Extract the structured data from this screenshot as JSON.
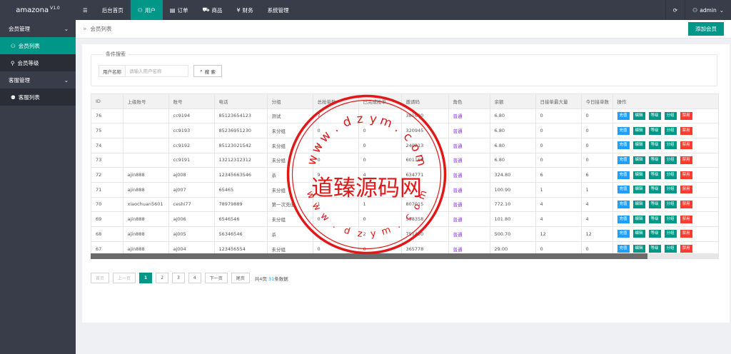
{
  "app": {
    "name": "amazona",
    "version": "V1.0"
  },
  "topnav": {
    "menu_icon": "hamburger-icon",
    "items": [
      {
        "label": "后台首页",
        "icon": ""
      },
      {
        "label": "用户",
        "icon": "user-icon"
      },
      {
        "label": "订单",
        "icon": "document-icon"
      },
      {
        "label": "商品",
        "icon": "cart-icon"
      },
      {
        "label": "财务",
        "icon": "yen-icon"
      },
      {
        "label": "系统管理",
        "icon": ""
      }
    ],
    "active_index": 1,
    "refresh_icon": "refresh-icon",
    "user": "admin"
  },
  "sidebar": {
    "groups": [
      {
        "label": "会员管理",
        "expanded": true,
        "items": [
          {
            "label": "会员列表",
            "icon": "user-icon",
            "active": true
          },
          {
            "label": "会员等级",
            "icon": "tag-icon",
            "active": false
          }
        ]
      },
      {
        "label": "客服管理",
        "expanded": true,
        "items": [
          {
            "label": "客服列表",
            "icon": "group-icon",
            "active": false
          }
        ]
      }
    ]
  },
  "breadcrumb": {
    "label": "会员列表"
  },
  "toolbar": {
    "add_label": "添加会员"
  },
  "search": {
    "legend": "条件搜索",
    "label": "用户名称",
    "placeholder": "请输入用户名称",
    "button": "搜 索"
  },
  "table": {
    "headers": [
      "ID",
      "上级账号",
      "账号",
      "电话",
      "分组",
      "总抢单数",
      "已完成抢单",
      "邀请码",
      "角色",
      "余额",
      "日接单最大量",
      "今日接单数",
      "操作"
    ],
    "rows": [
      [
        "76",
        "",
        "cc9194",
        "85123654123",
        "测试",
        "7",
        "",
        "381680",
        "普通",
        "6.80",
        "0",
        "0"
      ],
      [
        "75",
        "",
        "cc9193",
        "85236951230",
        "未分组",
        "0",
        "0",
        "320945",
        "普通",
        "6.80",
        "0",
        "0"
      ],
      [
        "74",
        "",
        "cc9192",
        "85123021542",
        "未分组",
        "0",
        "0",
        "240213",
        "普通",
        "6.80",
        "0",
        "0"
      ],
      [
        "73",
        "",
        "cc9191",
        "13212312312",
        "未分组",
        "0",
        "0",
        "601169",
        "普通",
        "6.80",
        "0",
        "0"
      ],
      [
        "72",
        "ajin888",
        "aj008",
        "12345663546",
        "杀",
        "9",
        "4",
        "634771",
        "普通",
        "324.80",
        "6",
        "6"
      ],
      [
        "71",
        "ajin888",
        "aj007",
        "65465",
        "未分组",
        "",
        "",
        "",
        "普通",
        "100.90",
        "1",
        "1"
      ],
      [
        "70",
        "xiaochuan5601",
        "ceshi77",
        "78979889",
        "第一次充值",
        "1",
        "1",
        "807015",
        "普通",
        "772.10",
        "4",
        "4"
      ],
      [
        "69",
        "ajin888",
        "aj006",
        "6546546",
        "未分组",
        "0",
        "0",
        "598358",
        "普通",
        "101.80",
        "4",
        "4"
      ],
      [
        "68",
        "ajin888",
        "aj005",
        "56346546",
        "杀",
        "",
        "2",
        "751450",
        "普通",
        "500.70",
        "12",
        "12"
      ],
      [
        "67",
        "ajin888",
        "aj004",
        "123456554",
        "未分组",
        "0",
        "0",
        "365778",
        "普通",
        "29.00",
        "0",
        "0"
      ]
    ],
    "actions": [
      "充值",
      "编辑",
      "等级",
      "分组",
      "禁用"
    ]
  },
  "pagination": {
    "first": "首页",
    "prev": "上一页",
    "pages": [
      "1",
      "2",
      "3",
      "4"
    ],
    "current": "1",
    "next": "下一页",
    "last": "尾页",
    "info_prefix": "共4页",
    "total": "31",
    "info_suffix": "条数据"
  },
  "watermark": {
    "text": "道臻源码网",
    "url": "www.dzym.com"
  },
  "colors": {
    "primary": "#009688",
    "dark": "#393d49",
    "danger": "#ff3b30",
    "info": "#1e9fff",
    "stamp": "#e01818"
  }
}
